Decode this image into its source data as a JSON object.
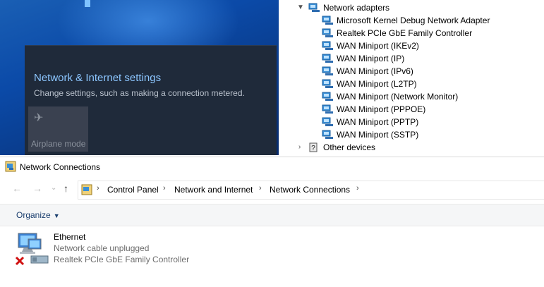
{
  "flyout": {
    "title": "Network & Internet settings",
    "description": "Change settings, such as making a connection metered.",
    "airplane_label": "Airplane mode"
  },
  "device_manager": {
    "category": "Network adapters",
    "adapters": [
      "Microsoft Kernel Debug Network Adapter",
      "Realtek PCIe GbE Family Controller",
      "WAN Miniport (IKEv2)",
      "WAN Miniport (IP)",
      "WAN Miniport (IPv6)",
      "WAN Miniport (L2TP)",
      "WAN Miniport (Network Monitor)",
      "WAN Miniport (PPPOE)",
      "WAN Miniport (PPTP)",
      "WAN Miniport (SSTP)"
    ],
    "other_category": "Other devices"
  },
  "window": {
    "title": "Network Connections",
    "breadcrumb": [
      "Control Panel",
      "Network and Internet",
      "Network Connections"
    ],
    "organize_label": "Organize"
  },
  "connection": {
    "name": "Ethernet",
    "status": "Network cable unplugged",
    "device": "Realtek PCIe GbE Family Controller"
  },
  "colors": {
    "flyout_link": "#8cc6ff",
    "flyout_bg": "#1f2a3a",
    "error_x": "#d01010"
  }
}
